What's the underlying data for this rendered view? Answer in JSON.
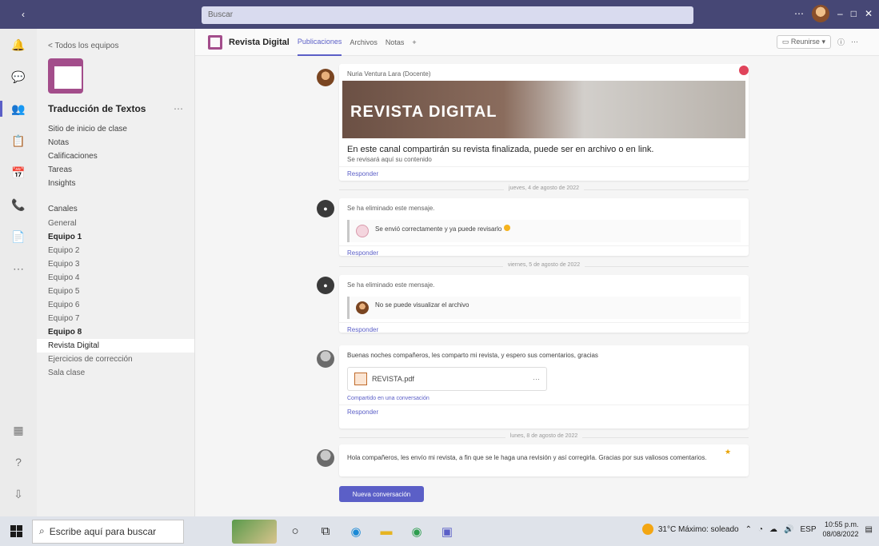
{
  "titlebar": {
    "search_placeholder": "Buscar"
  },
  "app_bar": {
    "items": [
      "Actividad",
      "Chat",
      "Equipos",
      "Tareas",
      "Calendario",
      "Llamadas",
      "Archivos"
    ],
    "bottom": [
      "Aplicaciones",
      "Ayuda"
    ]
  },
  "sidebar": {
    "back_label": "< Todos los equipos",
    "team_name": "Traducción de Textos",
    "team_links": [
      "Sitio de inicio de clase",
      "Notas",
      "Calificaciones",
      "Tareas",
      "Insights"
    ],
    "channels_label": "Canales",
    "channels": [
      {
        "label": "General",
        "bold": false,
        "selected": false
      },
      {
        "label": "Equipo 1",
        "bold": true,
        "selected": false
      },
      {
        "label": "Equipo 2",
        "bold": false,
        "selected": false
      },
      {
        "label": "Equipo 3",
        "bold": false,
        "selected": false
      },
      {
        "label": "Equipo 4",
        "bold": false,
        "selected": false
      },
      {
        "label": "Equipo 5",
        "bold": false,
        "selected": false
      },
      {
        "label": "Equipo 6",
        "bold": false,
        "selected": false
      },
      {
        "label": "Equipo 7",
        "bold": false,
        "selected": false
      },
      {
        "label": "Equipo 8",
        "bold": true,
        "selected": false
      },
      {
        "label": "Revista Digital",
        "bold": false,
        "selected": true
      },
      {
        "label": "Ejercicios de corrección",
        "bold": false,
        "selected": false
      },
      {
        "label": "Sala clase",
        "bold": false,
        "selected": false
      }
    ]
  },
  "channel_header": {
    "title": "Revista Digital",
    "tabs": [
      "Publicaciones",
      "Archivos",
      "Notas",
      "+"
    ],
    "meet_label": "Reunirse"
  },
  "feed": {
    "post1": {
      "meta": "Nuria Ventura Lara (Docente)",
      "banner_text": "REVISTA DIGITAL",
      "title": "En este canal compartirán su revista finalizada, puede ser en archivo o en link.",
      "subtitle": "Se revisará aquí su contenido",
      "reply": "Responder"
    },
    "divider1": "jueves, 4 de agosto de 2022",
    "post2": {
      "meta": "Se ha eliminado este mensaje.",
      "quote_text": "Se envió correctamente y ya puede revisarlo",
      "reply": "Responder"
    },
    "divider2": "viernes, 5 de agosto de 2022",
    "post3": {
      "meta": "Se ha eliminado este mensaje.",
      "quote_text": "No se puede visualizar el archivo",
      "reply": "Responder"
    },
    "post4": {
      "text": "Buenas noches compañeros, les comparto mi revista, y espero sus comentarios, gracias",
      "file_name": "REVISTA.pdf",
      "file_link": "Compartido en una conversación",
      "reply": "Responder"
    },
    "divider3": "lunes, 8 de agosto de 2022",
    "post5": {
      "text": "Hola compañeros, les envío mi revista, a fin que se le haga una revisión y así corregirla. Gracias por sus valiosos comentarios."
    },
    "new_conversation": "Nueva conversación"
  },
  "taskbar": {
    "search_placeholder": "Escribe aquí para buscar",
    "weather": "31°C  Máximo: soleado",
    "lang": "ESP",
    "time": "10:55 p.m.",
    "date": "08/08/2022"
  },
  "colors": {
    "accent": "#5b5fc7",
    "titlebar": "#464775",
    "team_tile": "#a34d8b"
  }
}
